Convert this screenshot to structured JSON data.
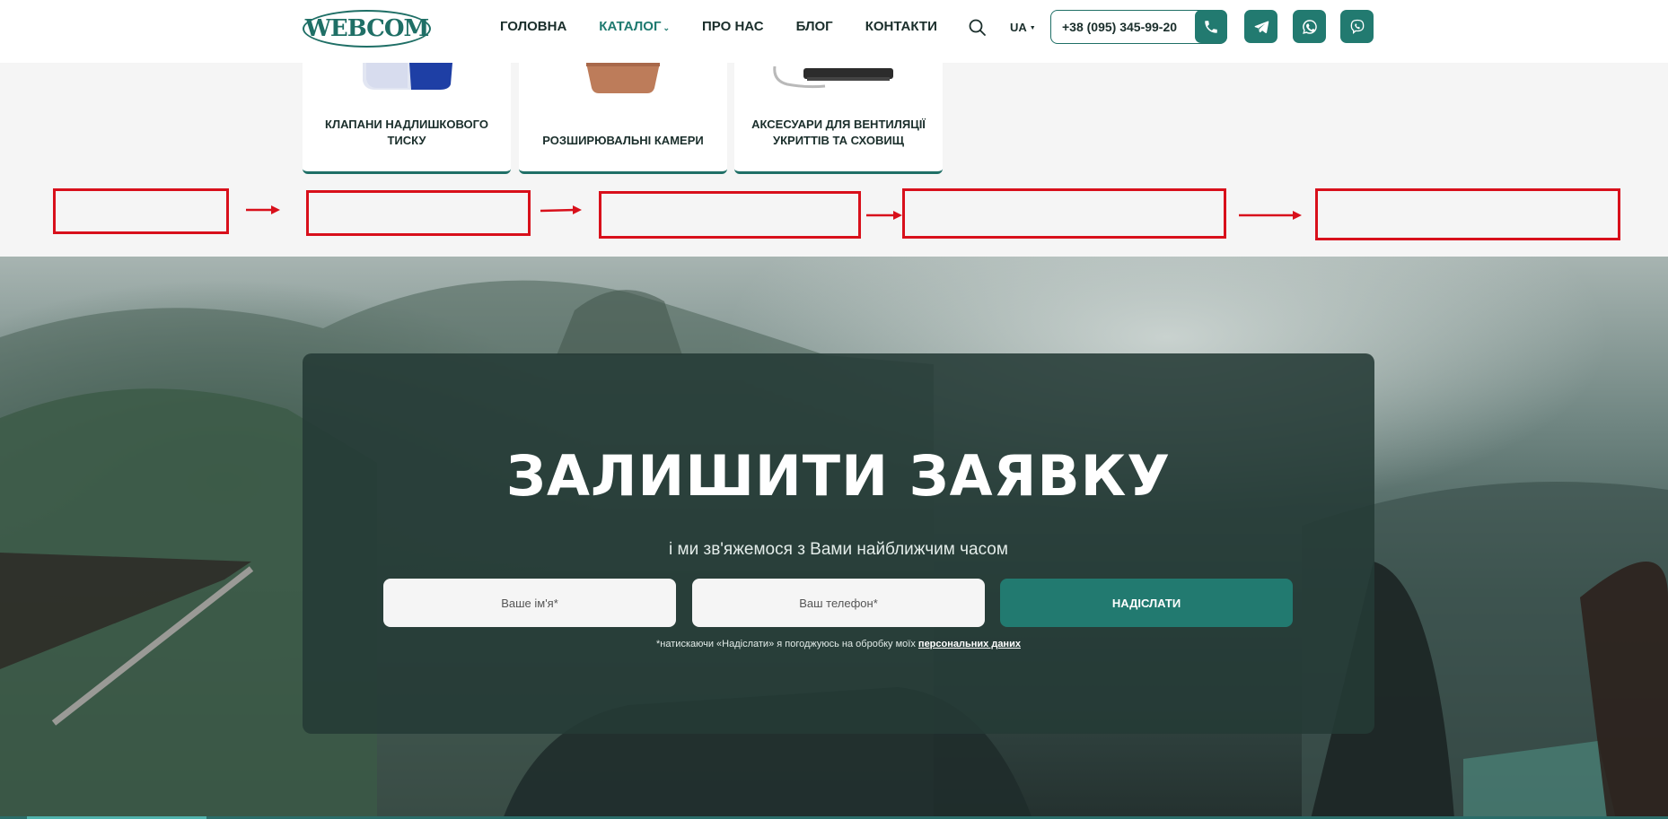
{
  "header": {
    "logo": "WEBCOM",
    "nav": [
      {
        "label": "ГОЛОВНА",
        "active": false
      },
      {
        "label": "КАТАЛОГ",
        "active": true
      },
      {
        "label": "ПРО НАС",
        "active": false
      },
      {
        "label": "БЛОГ",
        "active": false
      },
      {
        "label": "КОНТАКТИ",
        "active": false
      }
    ],
    "language": "UA",
    "phone": "+38 (095) 345-99-20",
    "icons": {
      "search": "search-icon",
      "phone": "phone-icon",
      "telegram": "telegram-icon",
      "whatsapp": "whatsapp-icon",
      "viber": "viber-icon"
    }
  },
  "catalog_cards": [
    {
      "title": "КЛАПАНИ НАДЛИШКОВОГО ТИСКУ"
    },
    {
      "title": "РОЗШИРЮВАЛЬНІ КАМЕРИ"
    },
    {
      "title": "АКСЕСУАРИ ДЛЯ ВЕНТИЛЯЦІЇ УКРИТТІВ ТА СХОВИЩ"
    }
  ],
  "form": {
    "title": "ЗАЛИШИТИ ЗАЯВКУ",
    "subtitle": "і ми зв'яжемося з Вами найближчим часом",
    "name_placeholder": "Ваше ім'я*",
    "phone_placeholder": "Ваш телефон*",
    "submit_label": "НАДІСЛАТИ",
    "consent_text": "*натискаючи «Надіслати» я погоджуюсь на обробку моїх ",
    "consent_link": "персональних даних"
  },
  "colors": {
    "brand": "#227a70",
    "annotation": "#d8101b"
  }
}
